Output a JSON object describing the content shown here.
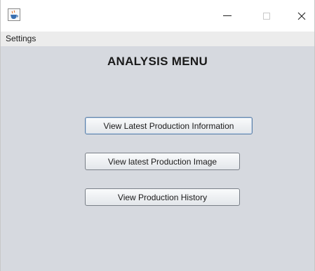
{
  "window": {
    "title": "",
    "icon": "java-cup-icon",
    "controls": {
      "minimize": "–",
      "maximize": "□",
      "close": "✕"
    }
  },
  "menubar": {
    "items": [
      {
        "label": "Settings"
      }
    ]
  },
  "main": {
    "title": "ANALYSIS MENU",
    "buttons": [
      {
        "label": "View Latest Production Information"
      },
      {
        "label": "View latest Production Image"
      },
      {
        "label": "View Production History"
      }
    ]
  }
}
